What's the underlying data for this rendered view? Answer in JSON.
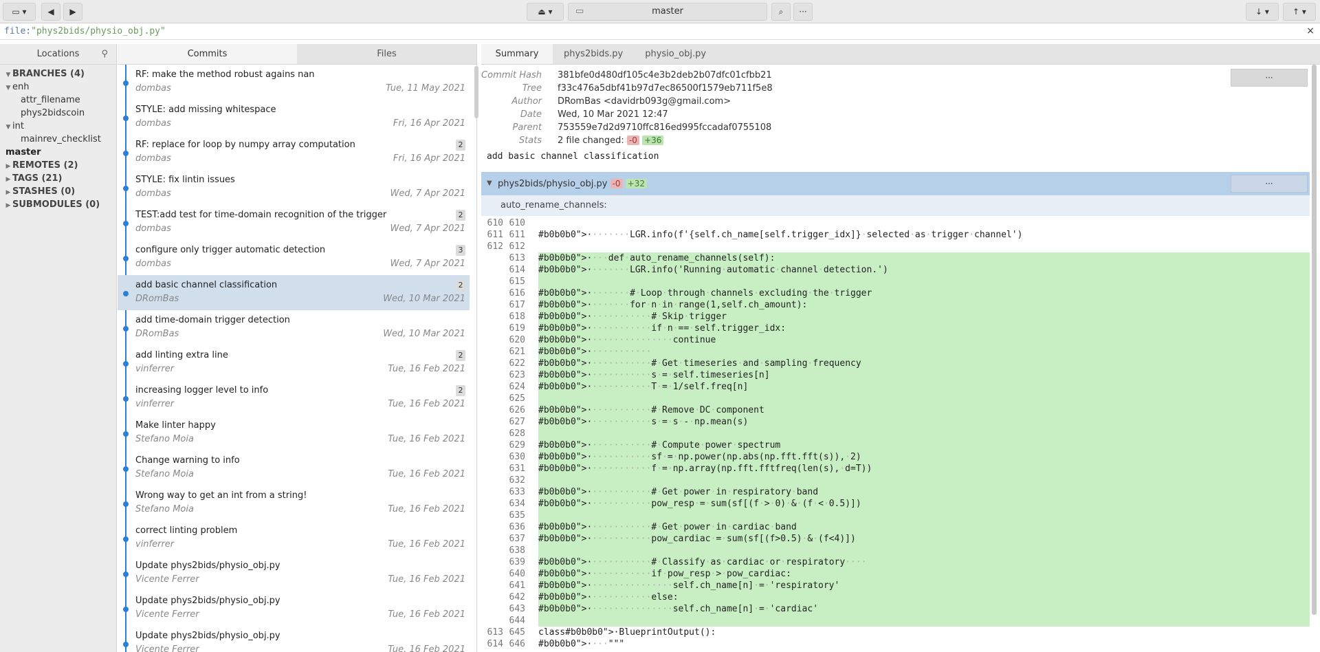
{
  "toolbar": {
    "branch": "master"
  },
  "filter": {
    "prefix": "file:",
    "value": "\"phys2bids/physio_obj.py\"",
    "close": "×"
  },
  "locations": {
    "tab": "Locations",
    "rows": [
      {
        "label": "BRANCHES (4)",
        "head": true,
        "caret": "▼",
        "indent": 0
      },
      {
        "label": "enh",
        "head": false,
        "caret": "▼",
        "indent": 0
      },
      {
        "label": "attr_filename",
        "head": false,
        "caret": "",
        "indent": 2
      },
      {
        "label": "phys2bidscoin",
        "head": false,
        "caret": "",
        "indent": 2
      },
      {
        "label": "int",
        "head": false,
        "caret": "▼",
        "indent": 0
      },
      {
        "label": "mainrev_checklist",
        "head": false,
        "caret": "",
        "indent": 2
      },
      {
        "label": "master",
        "head": true,
        "caret": "",
        "indent": 1
      },
      {
        "label": "REMOTES (2)",
        "head": true,
        "caret": "▶",
        "indent": 0
      },
      {
        "label": "TAGS (21)",
        "head": true,
        "caret": "▶",
        "indent": 0
      },
      {
        "label": "STASHES (0)",
        "head": true,
        "caret": "▶",
        "indent": 0
      },
      {
        "label": "SUBMODULES (0)",
        "head": true,
        "caret": "▶",
        "indent": 0
      }
    ]
  },
  "tabs": {
    "commits": "Commits",
    "files": "Files"
  },
  "commits": [
    {
      "msg": "RF: make the method robust agains nan",
      "author": "dombas",
      "date": "Tue, 11 May 2021",
      "badge": ""
    },
    {
      "msg": "STYLE: add missing whitespace",
      "author": "dombas",
      "date": "Fri, 16 Apr 2021",
      "badge": ""
    },
    {
      "msg": "RF: replace for loop by numpy array computation",
      "author": "dombas",
      "date": "Fri, 16 Apr 2021",
      "badge": "2"
    },
    {
      "msg": "STYLE: fix lintin issues",
      "author": "dombas",
      "date": "Wed, 7 Apr 2021",
      "badge": ""
    },
    {
      "msg": "TEST:add test for time-domain recognition of the trigger",
      "author": "dombas",
      "date": "Wed, 7 Apr 2021",
      "badge": "2"
    },
    {
      "msg": "configure only trigger automatic detection",
      "author": "dombas",
      "date": "Wed, 7 Apr 2021",
      "badge": "3"
    },
    {
      "msg": "add basic channel classification",
      "author": "DRomBas",
      "date": "Wed, 10 Mar 2021",
      "badge": "2",
      "selected": true
    },
    {
      "msg": "add time-domain trigger detection",
      "author": "DRomBas",
      "date": "Wed, 10 Mar 2021",
      "badge": ""
    },
    {
      "msg": "add linting extra line",
      "author": "vinferrer",
      "date": "Tue, 16 Feb 2021",
      "badge": "2"
    },
    {
      "msg": "increasing logger level to info",
      "author": "vinferrer",
      "date": "Tue, 16 Feb 2021",
      "badge": "2"
    },
    {
      "msg": "Make linter happy",
      "author": "Stefano Moia",
      "date": "Tue, 16 Feb 2021",
      "badge": ""
    },
    {
      "msg": "Change warning to info",
      "author": "Stefano Moia",
      "date": "Tue, 16 Feb 2021",
      "badge": ""
    },
    {
      "msg": "Wrong way to get an int from a string!",
      "author": "Stefano Moia",
      "date": "Tue, 16 Feb 2021",
      "badge": ""
    },
    {
      "msg": "correct linting problem",
      "author": "vinferrer",
      "date": "Tue, 16 Feb 2021",
      "badge": ""
    },
    {
      "msg": "Update phys2bids/physio_obj.py",
      "author": "Vicente Ferrer",
      "date": "Tue, 16 Feb 2021",
      "badge": ""
    },
    {
      "msg": "Update phys2bids/physio_obj.py",
      "author": "Vicente Ferrer",
      "date": "Tue, 16 Feb 2021",
      "badge": ""
    },
    {
      "msg": "Update phys2bids/physio_obj.py",
      "author": "Vicente Ferrer",
      "date": "Tue, 16 Feb 2021",
      "badge": ""
    }
  ],
  "detail_tabs": [
    "Summary",
    "phys2bids.py",
    "physio_obj.py"
  ],
  "meta": [
    {
      "label": "Commit Hash",
      "value": "381bfe0d480df105c4e3b2deb2b07dfc01cfbb21"
    },
    {
      "label": "Tree",
      "value": "f33c476a5dbf41b97d7ec86500f1579eb711f5e8"
    },
    {
      "label": "Author",
      "value": "DRomBas <davidrb093g@gmail.com>"
    },
    {
      "label": "Date",
      "value": "Wed, 10 Mar 2021 12:47"
    },
    {
      "label": "Parent",
      "value": "753559e7d2d9710ffc816ed995fccadaf0755108"
    }
  ],
  "stats": {
    "label": "Stats",
    "text": "2 file changed:",
    "del": "-0",
    "add": "+36"
  },
  "more": "···",
  "subject": "add basic channel classification",
  "file": {
    "name": "phys2bids/physio_obj.py",
    "del": "-0",
    "add": "+32"
  },
  "hunk": "auto_rename_channels:",
  "code": [
    {
      "o": "610",
      "n": "610",
      "t": "",
      "a": false
    },
    {
      "o": "611",
      "n": "611",
      "t": "········LGR.info(f'{self.ch_name[self.trigger_idx]}·selected·as·trigger·channel')",
      "a": false
    },
    {
      "o": "612",
      "n": "612",
      "t": "",
      "a": false
    },
    {
      "o": "",
      "n": "613",
      "t": "····def·auto_rename_channels(self):",
      "a": true
    },
    {
      "o": "",
      "n": "614",
      "t": "········LGR.info('Running·automatic·channel·detection.')",
      "a": true
    },
    {
      "o": "",
      "n": "615",
      "t": "",
      "a": true
    },
    {
      "o": "",
      "n": "616",
      "t": "········#·Loop·through·channels·excluding·the·trigger",
      "a": true
    },
    {
      "o": "",
      "n": "617",
      "t": "········for·n·in·range(1,self.ch_amount):",
      "a": true
    },
    {
      "o": "",
      "n": "618",
      "t": "············#·Skip·trigger",
      "a": true
    },
    {
      "o": "",
      "n": "619",
      "t": "············if·n·==·self.trigger_idx:",
      "a": true
    },
    {
      "o": "",
      "n": "620",
      "t": "················continue",
      "a": true
    },
    {
      "o": "",
      "n": "621",
      "t": "············",
      "a": true
    },
    {
      "o": "",
      "n": "622",
      "t": "············#·Get·timeseries·and·sampling·frequency",
      "a": true
    },
    {
      "o": "",
      "n": "623",
      "t": "············s·=·self.timeseries[n]",
      "a": true
    },
    {
      "o": "",
      "n": "624",
      "t": "············T·=·1/self.freq[n]",
      "a": true
    },
    {
      "o": "",
      "n": "625",
      "t": "",
      "a": true
    },
    {
      "o": "",
      "n": "626",
      "t": "············#·Remove·DC·component",
      "a": true
    },
    {
      "o": "",
      "n": "627",
      "t": "············s·=·s·-·np.mean(s)",
      "a": true
    },
    {
      "o": "",
      "n": "628",
      "t": "",
      "a": true
    },
    {
      "o": "",
      "n": "629",
      "t": "············#·Compute·power·spectrum",
      "a": true
    },
    {
      "o": "",
      "n": "630",
      "t": "············sf·=·np.power(np.abs(np.fft.fft(s)),·2)",
      "a": true
    },
    {
      "o": "",
      "n": "631",
      "t": "············f·=·np.array(np.fft.fftfreq(len(s),·d=T))",
      "a": true
    },
    {
      "o": "",
      "n": "632",
      "t": "",
      "a": true
    },
    {
      "o": "",
      "n": "633",
      "t": "············#·Get·power·in·respiratory·band",
      "a": true
    },
    {
      "o": "",
      "n": "634",
      "t": "············pow_resp·=·sum(sf[(f·>·0)·&·(f·<·0.5)])",
      "a": true
    },
    {
      "o": "",
      "n": "635",
      "t": "",
      "a": true
    },
    {
      "o": "",
      "n": "636",
      "t": "············#·Get·power·in·cardiac·band",
      "a": true
    },
    {
      "o": "",
      "n": "637",
      "t": "············pow_cardiac·=·sum(sf[(f>0.5)·&·(f<4)])",
      "a": true
    },
    {
      "o": "",
      "n": "638",
      "t": "",
      "a": true
    },
    {
      "o": "",
      "n": "639",
      "t": "············#·Classify·as·cardiac·or·respiratory····",
      "a": true
    },
    {
      "o": "",
      "n": "640",
      "t": "············if·pow_resp·>·pow_cardiac:",
      "a": true
    },
    {
      "o": "",
      "n": "641",
      "t": "················self.ch_name[n]·=·'respiratory'",
      "a": true
    },
    {
      "o": "",
      "n": "642",
      "t": "············else:",
      "a": true
    },
    {
      "o": "",
      "n": "643",
      "t": "················self.ch_name[n]·=·'cardiac'",
      "a": true
    },
    {
      "o": "",
      "n": "644",
      "t": "",
      "a": true
    },
    {
      "o": "613",
      "n": "645",
      "t": "class·BlueprintOutput():",
      "a": false
    },
    {
      "o": "614",
      "n": "646",
      "t": "····\"\"\"",
      "a": false
    }
  ]
}
